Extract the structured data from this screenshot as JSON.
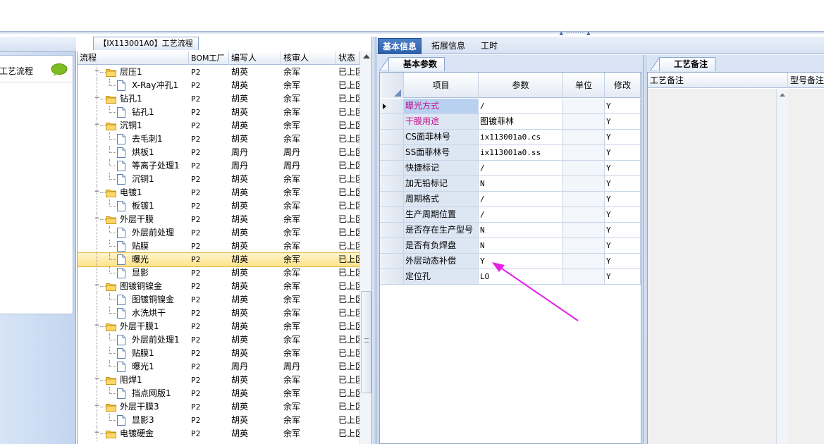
{
  "left_panel": {
    "item_label": "返工艺流程"
  },
  "tree_panel": {
    "tab_title": "【IX113001A0】工艺流程",
    "columns": [
      "流程",
      "BOM工厂",
      "编写人",
      "核审人",
      "状态"
    ],
    "rows": [
      {
        "level": 1,
        "kind": "folder",
        "name": "层压1",
        "bom": "P2",
        "writer": "胡英",
        "reviewer": "余军",
        "status": "已上区"
      },
      {
        "level": 2,
        "kind": "file",
        "name": "X-Ray冲孔1",
        "bom": "P2",
        "writer": "胡英",
        "reviewer": "余军",
        "status": "已上区"
      },
      {
        "level": 1,
        "kind": "folder",
        "name": "钻孔1",
        "bom": "P2",
        "writer": "胡英",
        "reviewer": "余军",
        "status": "已上区"
      },
      {
        "level": 2,
        "kind": "file",
        "name": "钻孔1",
        "bom": "P2",
        "writer": "胡英",
        "reviewer": "余军",
        "status": "已上区"
      },
      {
        "level": 1,
        "kind": "folder",
        "name": "沉铜1",
        "bom": "P2",
        "writer": "胡英",
        "reviewer": "余军",
        "status": "已上区"
      },
      {
        "level": 2,
        "kind": "file",
        "name": "去毛刺1",
        "bom": "P2",
        "writer": "胡英",
        "reviewer": "余军",
        "status": "已上区"
      },
      {
        "level": 2,
        "kind": "file",
        "name": "烘板1",
        "bom": "P2",
        "writer": "周丹",
        "reviewer": "周丹",
        "status": "已上区"
      },
      {
        "level": 2,
        "kind": "file",
        "name": "等离子处理1",
        "bom": "P2",
        "writer": "周丹",
        "reviewer": "周丹",
        "status": "已上区"
      },
      {
        "level": 2,
        "kind": "file",
        "name": "沉铜1",
        "bom": "P2",
        "writer": "胡英",
        "reviewer": "余军",
        "status": "已上区"
      },
      {
        "level": 1,
        "kind": "folder",
        "name": "电镀1",
        "bom": "P2",
        "writer": "胡英",
        "reviewer": "余军",
        "status": "已上区"
      },
      {
        "level": 2,
        "kind": "file",
        "name": "板镀1",
        "bom": "P2",
        "writer": "胡英",
        "reviewer": "余军",
        "status": "已上区"
      },
      {
        "level": 1,
        "kind": "folder",
        "name": "外层干膜",
        "bom": "P2",
        "writer": "胡英",
        "reviewer": "余军",
        "status": "已上区"
      },
      {
        "level": 2,
        "kind": "file",
        "name": "外层前处理",
        "bom": "P2",
        "writer": "胡英",
        "reviewer": "余军",
        "status": "已上区"
      },
      {
        "level": 2,
        "kind": "file",
        "name": "贴膜",
        "bom": "P2",
        "writer": "胡英",
        "reviewer": "余军",
        "status": "已上区"
      },
      {
        "level": 2,
        "kind": "file",
        "name": "曝光",
        "bom": "P2",
        "writer": "胡英",
        "reviewer": "余军",
        "status": "已上区",
        "selected": true
      },
      {
        "level": 2,
        "kind": "file",
        "name": "显影",
        "bom": "P2",
        "writer": "胡英",
        "reviewer": "余军",
        "status": "已上区"
      },
      {
        "level": 1,
        "kind": "folder",
        "name": "图镀铜镍金",
        "bom": "P2",
        "writer": "胡英",
        "reviewer": "余军",
        "status": "已上区"
      },
      {
        "level": 2,
        "kind": "file",
        "name": "图镀铜镍金",
        "bom": "P2",
        "writer": "胡英",
        "reviewer": "余军",
        "status": "已上区"
      },
      {
        "level": 2,
        "kind": "file",
        "name": "水洗烘干",
        "bom": "P2",
        "writer": "胡英",
        "reviewer": "余军",
        "status": "已上区"
      },
      {
        "level": 1,
        "kind": "folder",
        "name": "外层干膜1",
        "bom": "P2",
        "writer": "胡英",
        "reviewer": "余军",
        "status": "已上区"
      },
      {
        "level": 2,
        "kind": "file",
        "name": "外层前处理1",
        "bom": "P2",
        "writer": "胡英",
        "reviewer": "余军",
        "status": "已上区"
      },
      {
        "level": 2,
        "kind": "file",
        "name": "贴膜1",
        "bom": "P2",
        "writer": "胡英",
        "reviewer": "余军",
        "status": "已上区"
      },
      {
        "level": 2,
        "kind": "file",
        "name": "曝光1",
        "bom": "P2",
        "writer": "周丹",
        "reviewer": "周丹",
        "status": "已上区"
      },
      {
        "level": 1,
        "kind": "folder",
        "name": "阻焊1",
        "bom": "P2",
        "writer": "胡英",
        "reviewer": "余军",
        "status": "已上区"
      },
      {
        "level": 2,
        "kind": "file",
        "name": "挡点网版1",
        "bom": "P2",
        "writer": "胡英",
        "reviewer": "余军",
        "status": "已上区"
      },
      {
        "level": 1,
        "kind": "folder",
        "name": "外层干膜3",
        "bom": "P2",
        "writer": "胡英",
        "reviewer": "余军",
        "status": "已上区"
      },
      {
        "level": 2,
        "kind": "file",
        "name": "显影3",
        "bom": "P2",
        "writer": "胡英",
        "reviewer": "余军",
        "status": "已上区"
      },
      {
        "level": 1,
        "kind": "folder",
        "name": "电镀硬金",
        "bom": "P2",
        "writer": "胡英",
        "reviewer": "余军",
        "status": "已上区"
      }
    ]
  },
  "main_tabs": [
    {
      "label": "基本信息",
      "active": true
    },
    {
      "label": "拓展信息",
      "active": false
    },
    {
      "label": "工时",
      "active": false
    }
  ],
  "basic_params": {
    "tab_label": "基本参数",
    "columns": [
      "项目",
      "参数",
      "单位",
      "修改"
    ],
    "rows": [
      {
        "name": "曝光方式",
        "value": "/",
        "unit": "",
        "modified": "Y",
        "highlight": true,
        "current": true
      },
      {
        "name": "干膜用途",
        "value": "图镀菲林",
        "unit": "",
        "modified": "Y",
        "highlight": true,
        "cjk": true
      },
      {
        "name": "CS面菲林号",
        "value": "ix113001a0.cs",
        "unit": "",
        "modified": "Y"
      },
      {
        "name": "SS面菲林号",
        "value": "ix113001a0.ss",
        "unit": "",
        "modified": "Y"
      },
      {
        "name": "快捷标记",
        "value": "/",
        "unit": "",
        "modified": "Y"
      },
      {
        "name": "加无铅标记",
        "value": "N",
        "unit": "",
        "modified": "Y"
      },
      {
        "name": "周期格式",
        "value": "/",
        "unit": "",
        "modified": "Y"
      },
      {
        "name": "生产周期位置",
        "value": "/",
        "unit": "",
        "modified": "Y"
      },
      {
        "name": "是否存在生产型号",
        "value": "N",
        "unit": "",
        "modified": "Y"
      },
      {
        "name": "是否有负焊盘",
        "value": "N",
        "unit": "",
        "modified": "Y"
      },
      {
        "name": "外层动态补偿",
        "value": "Y",
        "unit": "",
        "modified": "Y"
      },
      {
        "name": "定位孔",
        "value": "LO",
        "unit": "",
        "modified": "Y"
      }
    ]
  },
  "remarks": {
    "tab_label": "工艺备注",
    "columns": [
      "工艺备注",
      "型号备注"
    ]
  },
  "colors": {
    "highlight_text": "#c2108a",
    "annotation_arrow": "#e61ee6",
    "active_tab": "#2b5ea8",
    "selection": "#ffe38a"
  }
}
